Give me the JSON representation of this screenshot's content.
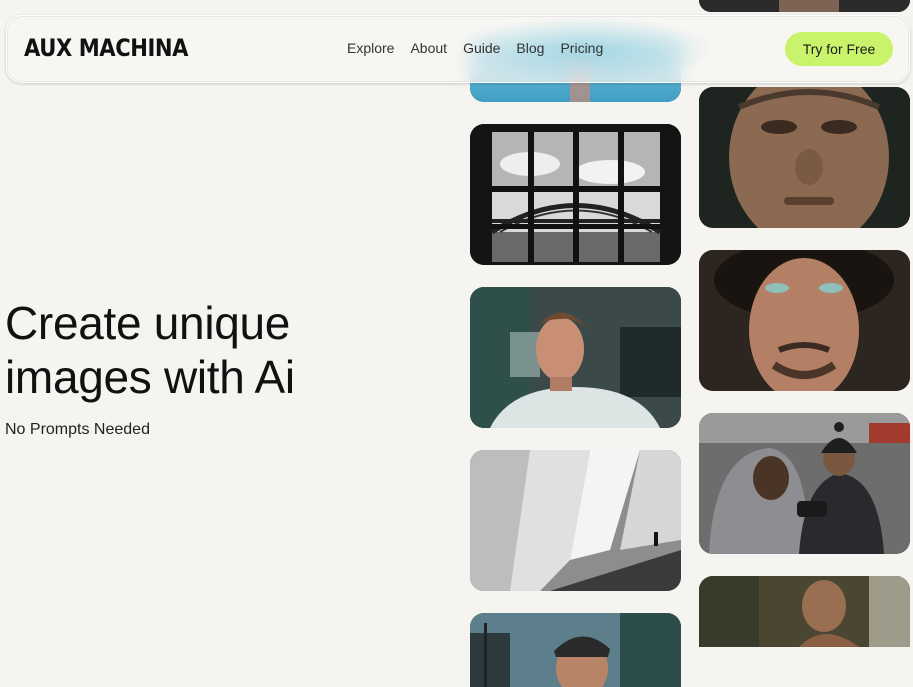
{
  "header": {
    "logo": "AUX MACHINA",
    "nav": [
      {
        "label": "Explore"
      },
      {
        "label": "About"
      },
      {
        "label": "Guide"
      },
      {
        "label": "Blog"
      },
      {
        "label": "Pricing"
      }
    ],
    "cta_label": "Try for Free"
  },
  "hero": {
    "title_line1": "Create unique",
    "title_line2": "images with Ai",
    "subtitle": "No Prompts Needed"
  },
  "colors": {
    "background": "#f6f4f0",
    "accent": "#c9f36a"
  }
}
